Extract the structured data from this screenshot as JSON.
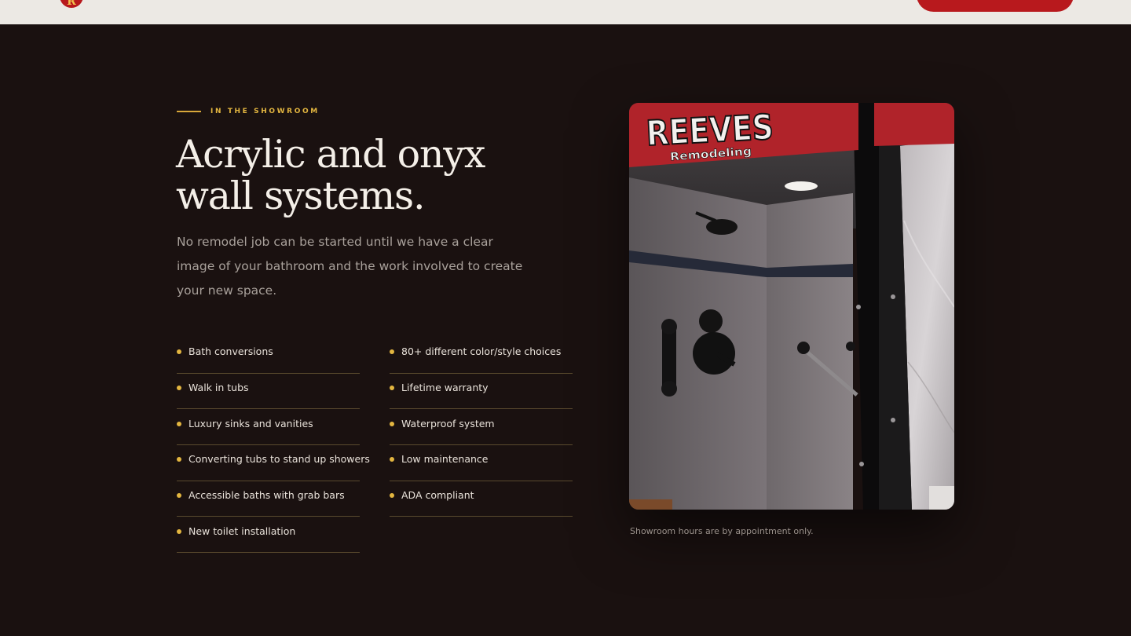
{
  "header": {
    "logo_letter": "R",
    "cta_label": ""
  },
  "section": {
    "eyebrow": "IN THE SHOWROOM",
    "title_line1": "Acrylic and onyx",
    "title_line2": "wall systems.",
    "lead": "No remodel job can be started until we have a clear image of your bathroom and the work involved to create your new space.",
    "services": [
      "Bath conversions",
      "Walk in tubs",
      "Luxury sinks and vanities",
      "Converting tubs to stand up showers",
      "Accessible baths with grab bars",
      "New toilet installation"
    ],
    "benefits": [
      "80+ different color/style choices",
      "Lifetime warranty",
      "Waterproof system",
      "Low maintenance",
      "ADA compliant"
    ],
    "photo": {
      "sign_text": "REEVES",
      "sign_sub": "Remodeling"
    },
    "caption": "Showroom hours are by appointment only."
  },
  "colors": {
    "background": "#1a1110",
    "accent_gold": "#e3b640",
    "brand_red": "#b8191d",
    "header_bg": "#ece9e4"
  }
}
